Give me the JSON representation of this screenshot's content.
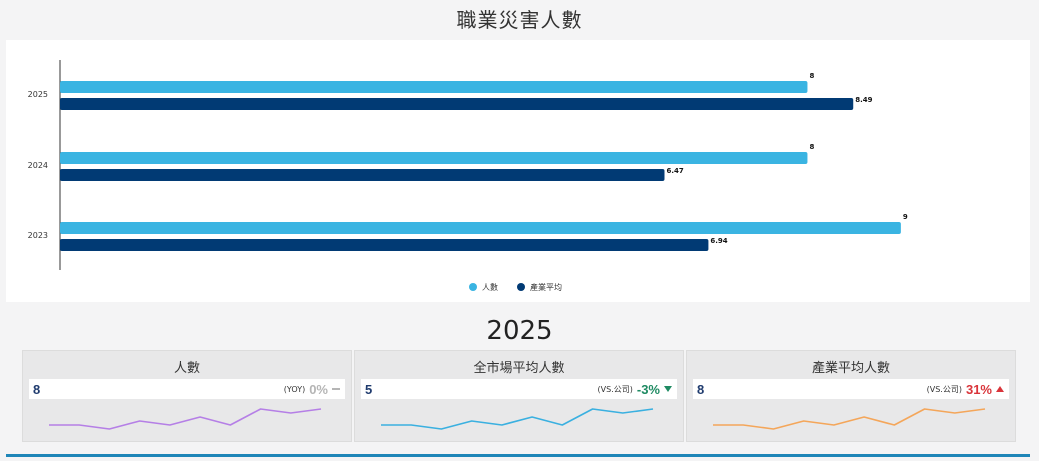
{
  "page": {
    "title": "職業災害人數",
    "year_heading": "2025"
  },
  "colors": {
    "series_1": "#3ab4e2",
    "series_2": "#013a74",
    "axis": "#333333"
  },
  "chart_data": {
    "type": "bar",
    "orientation": "horizontal",
    "categories": [
      "2025",
      "2024",
      "2023"
    ],
    "series": [
      {
        "name": "人數",
        "values": [
          8,
          8,
          9
        ],
        "labels": [
          "8",
          "8",
          "9"
        ]
      },
      {
        "name": "產業平均",
        "values": [
          8.49,
          6.47,
          6.94
        ],
        "labels": [
          "8.49",
          "6.47",
          "6.94"
        ]
      }
    ],
    "xlim": [
      0,
      10.2
    ],
    "grid": false,
    "legend_position": "bottom-center"
  },
  "cards": [
    {
      "title": "人數",
      "value": "8",
      "compare": "(YOY)",
      "change": "0%",
      "direction": "neutral",
      "color": "#b57fe6",
      "trend": [
        5,
        5,
        4,
        6,
        5,
        7,
        5,
        9,
        8,
        9
      ]
    },
    {
      "title": "全市場平均人數",
      "value": "5",
      "compare": "(VS.公司)",
      "change": "-3%",
      "direction": "down",
      "color": "#3ab0e0",
      "trend": [
        5,
        5,
        4,
        6,
        5,
        7,
        5,
        9,
        8,
        9
      ]
    },
    {
      "title": "產業平均人數",
      "value": "8",
      "compare": "(VS.公司)",
      "change": "31%",
      "direction": "up",
      "color": "#f4a65a",
      "trend": [
        5,
        5,
        4,
        6,
        5,
        7,
        5,
        9,
        8,
        9
      ]
    }
  ]
}
